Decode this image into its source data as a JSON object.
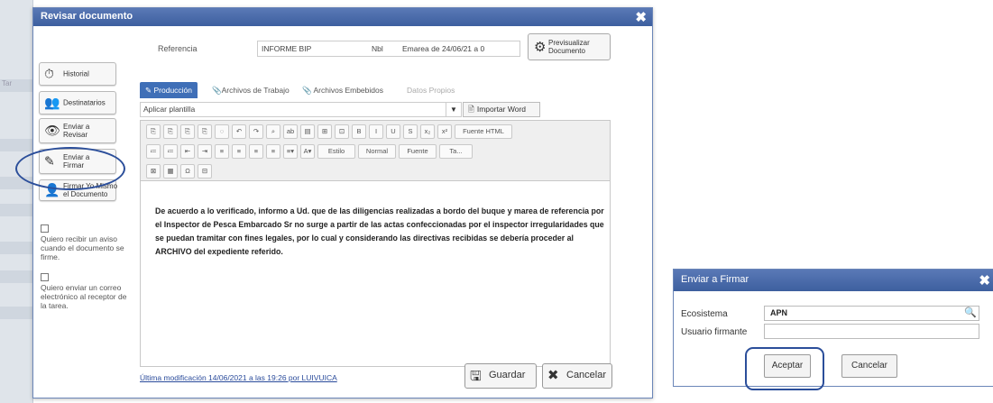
{
  "background": {
    "labels": [
      "Tar",
      "",
      "",
      "",
      "",
      ""
    ]
  },
  "main_dialog": {
    "title": "Revisar documento",
    "close": "✖",
    "sidebar": [
      {
        "icon": "history-icon",
        "glyph": "⏱",
        "label": "Historial"
      },
      {
        "icon": "users-icon",
        "glyph": "👥",
        "label": "Destinatarios"
      },
      {
        "icon": "eye-icon",
        "glyph": "👁",
        "label": "Enviar a\nRevisar"
      },
      {
        "icon": "sign-icon",
        "glyph": "✎",
        "label": "Enviar a\nFirmar"
      },
      {
        "icon": "user-icon",
        "glyph": "👤",
        "label": "Firmar Yo Mismo\nel Documento"
      }
    ],
    "checks": [
      "Quiero recibir un aviso cuando el documento se firme.",
      "Quiero enviar un correo electrónico al receptor de la tarea."
    ],
    "reference_label": "Referencia",
    "reference_parts": [
      "INFORME BIP",
      "Nbl",
      "Emarea de 24/06/21 a 0"
    ],
    "preview_label": "Previsualizar\nDocumento",
    "tabs": [
      "Producción",
      "Archivos de Trabajo",
      "Archivos Embebidos",
      "Datos Propios"
    ],
    "template_placeholder": "Aplicar plantilla",
    "import_word": "Importar Word",
    "toolbar": {
      "row1": [
        "⎘",
        "⎘",
        "⎘",
        "⎘",
        "◌",
        "↶",
        "↷",
        "⌕",
        "ab",
        "▤",
        "⊞",
        "⊡",
        "B",
        "I",
        "U",
        "S",
        "x₂",
        "x²",
        "Fuente HTML"
      ],
      "row2": [
        "≔",
        "≔",
        "⇤",
        "⇥",
        "≡",
        "≡",
        "≡",
        "≡",
        "≡▾",
        "A▾",
        "Estilo",
        "Normal",
        "Fuente",
        "Ta..."
      ],
      "row3": [
        "⊠",
        "▦",
        "Ω",
        "⊟"
      ]
    },
    "body_text": "De acuerdo a lo verificado, informo a Ud. que de las diligencias realizadas a bordo del buque y marea de referencia por el Inspector de Pesca Embarcado Sr                                    no surge a partir de las actas confeccionadas por el inspector irregularidades que se puedan tramitar con fines legales, por lo cual y considerando las directivas recibidas se debería proceder al ARCHIVO del expediente referido.",
    "last_modified": "Última modificación 14/06/2021 a las 19:26 por LUIVUICA",
    "save": "Guardar",
    "cancel": "Cancelar"
  },
  "sign_dialog": {
    "title": "Enviar a Firmar",
    "close": "✖",
    "ecosystem_label": "Ecosistema",
    "ecosystem_value": "APN",
    "signer_label": "Usuario firmante",
    "signer_value": "",
    "accept": "Aceptar",
    "cancel": "Cancelar"
  },
  "colors": {
    "titlebar": "#3d5f9f",
    "accent": "#3f6fb7",
    "highlight": "#2b4e9a"
  }
}
